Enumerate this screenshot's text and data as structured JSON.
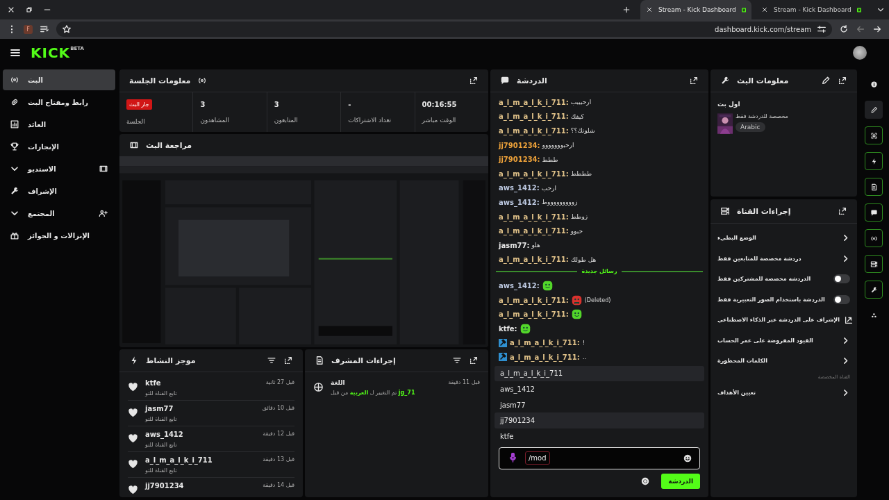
{
  "browser": {
    "tabs": [
      {
        "title": "Stream - Kick Dashboard",
        "selected": false
      },
      {
        "title": "Stream - Kick Dashboard",
        "selected": true
      }
    ],
    "profile": "F",
    "url": "dashboard.kick.com/stream"
  },
  "header": {
    "logo": "KICK",
    "logo_badge": "BETA"
  },
  "sidebar": {
    "items": [
      {
        "label": "البث",
        "kind": "link",
        "selected": true
      },
      {
        "label": "رابط ومفتاح البث",
        "kind": "link",
        "selected": false
      },
      {
        "label": "العائد",
        "kind": "link",
        "selected": false
      },
      {
        "label": "الإنجازات",
        "kind": "link",
        "selected": false
      },
      {
        "label": "الاستديو",
        "kind": "group",
        "selected": false
      },
      {
        "label": "الإشراف",
        "kind": "link",
        "selected": false
      },
      {
        "label": "المجتمع",
        "kind": "group",
        "selected": false
      },
      {
        "label": "الإنزالات و الجوائز",
        "kind": "link",
        "selected": false
      }
    ]
  },
  "session": {
    "title": "معلومات الجلسة",
    "stats": [
      {
        "kind": "number",
        "value": "00:16:55",
        "label": "الوقت مباشر"
      },
      {
        "kind": "number",
        "value": "-",
        "label": "تعداد الاشتراكات"
      },
      {
        "kind": "number",
        "value": "3",
        "label": "المتابعون"
      },
      {
        "kind": "number",
        "value": "3",
        "label": "المشاهدون"
      },
      {
        "kind": "badge",
        "value": "جار البث",
        "label": "الجلسة"
      }
    ]
  },
  "preview": {
    "title": "مراجعة البث",
    "kind": "picture"
  },
  "activity": {
    "title": "موجز النشاط",
    "items": [
      {
        "user": "ktfe",
        "time": "قبل 27 ثانية",
        "action": "تابع القناة للتو"
      },
      {
        "user": "jasm77",
        "time": "قبل 10 دقائق",
        "action": "تابع القناة للتو"
      },
      {
        "user": "aws_1412",
        "time": "قبل 12 دقيقة",
        "action": "تابع القناة للتو"
      },
      {
        "user": "a_l_m_a_l_k_i_711",
        "time": "قبل 13 دقيقة",
        "action": "تابع القناة للتو"
      },
      {
        "user": "jj7901234",
        "time": "قبل 14 دقيقة"
      }
    ]
  },
  "mod_actions": {
    "title": "إجراءات المشرف",
    "items": [
      {
        "title": "اللغة",
        "time": "قبل 11 دقيقة",
        "text": "**jg_71** تم التغيير ل **العربية** من قبل"
      }
    ]
  },
  "chat": {
    "title": "الدردشة",
    "messages": [
      {
        "kind": "text",
        "user": "a_l_m_a_l_k_i_711:",
        "color": "#e2c38a",
        "text": "ارحبيبب"
      },
      {
        "kind": "text",
        "user": "a_l_m_a_l_k_i_711:",
        "color": "#e2c38a",
        "text": "كيفك"
      },
      {
        "kind": "text",
        "user": "a_l_m_a_l_k_i_711:",
        "color": "#e2c38a",
        "text": "شلونك؟؟"
      },
      {
        "kind": "text",
        "user": "jj7901234:",
        "color": "#eea23a",
        "text": "ارحبووووووو"
      },
      {
        "kind": "text",
        "user": "jj7901234:",
        "color": "#eea23a",
        "text": "ططط"
      },
      {
        "kind": "text",
        "user": "a_l_m_a_l_k_i_711:",
        "color": "#e2c38a",
        "text": "طططط"
      },
      {
        "kind": "text",
        "user": "aws_1412:",
        "color": "#bcc8e0",
        "text": "ارحب"
      },
      {
        "kind": "text",
        "user": "aws_1412:",
        "color": "#bcc8e0",
        "text": "زوووووووووط"
      },
      {
        "kind": "text",
        "user": "a_l_m_a_l_k_i_711:",
        "color": "#e2c38a",
        "text": "زوطط"
      },
      {
        "kind": "text",
        "user": "a_l_m_a_l_k_i_711:",
        "color": "#e2c38a",
        "text": "حبوو"
      },
      {
        "kind": "text",
        "user": "jasm77:",
        "color": "#e8e8e8",
        "text": "هلو"
      },
      {
        "kind": "text",
        "user": "a_l_m_a_l_k_i_711:",
        "color": "#e2c38a",
        "text": "هل طولك"
      }
    ],
    "divider": "رسائل جديدة",
    "new_messages": [
      {
        "kind": "emote",
        "user": "aws_1412:",
        "color": "#bcc8e0",
        "deleted": false
      },
      {
        "kind": "emote",
        "user": "a_l_m_a_l_k_i_711:",
        "color": "#e2c38a",
        "deleted": true,
        "note": "(Deleted)"
      },
      {
        "kind": "emote",
        "user": "a_l_m_a_l_k_i_711:",
        "color": "#e2c38a",
        "deleted": false
      },
      {
        "kind": "emote",
        "user": "ktfe:",
        "color": "#e8e8e8",
        "deleted": false
      },
      {
        "kind": "action",
        "user": "a_l_m_a_l_k_i_711:",
        "color": "#e2c38a",
        "text": "!"
      },
      {
        "kind": "action",
        "user": "a_l_m_a_l_k_i_711:",
        "color": "#e2c38a",
        "text": ".."
      }
    ],
    "suggestions": [
      {
        "name": "a_l_m_a_l_k_i_711",
        "selected": true
      },
      {
        "name": "aws_1412",
        "selected": false
      },
      {
        "name": "jasm77",
        "selected": false
      },
      {
        "name": "jj7901234",
        "selected": true
      },
      {
        "name": "ktfe",
        "selected": false
      }
    ],
    "input_value": "/mod",
    "send": "الدردشة"
  },
  "stream_info": {
    "title": "معلومات البث",
    "stream_title": "اول بث",
    "category": "مخصصة للدردشة فقط",
    "tag": "Arabic"
  },
  "channel_actions": {
    "title": "إجراءات القناة",
    "items": [
      {
        "kind": "submenu",
        "label": "الوضع البطيء"
      },
      {
        "kind": "submenu",
        "label": "دردشة مخصصة للمتابعين فقط"
      },
      {
        "kind": "toggle",
        "label": "الدردشة مخصصة للمشتركين فقط",
        "on": false
      },
      {
        "kind": "toggle",
        "label": "الدردشة باستخدام الصور التعبيرية فقط",
        "on": false
      },
      {
        "kind": "external",
        "label": "الإشراف على الدردشة عبر الذكاء الاصطناعي"
      },
      {
        "kind": "submenu",
        "label": "القيود المفروضة على عمر الحساب"
      },
      {
        "kind": "submenu",
        "label": "الكلمات المحظورة"
      },
      {
        "kind": "section",
        "label": "القناة المخصصة"
      },
      {
        "kind": "submenu",
        "label": "تعيين الأهداف"
      }
    ]
  },
  "rail": [
    {
      "kind": "plain",
      "selected": false
    },
    {
      "kind": "plain",
      "selected": true
    },
    {
      "kind": "framed",
      "selected": false
    },
    {
      "kind": "framed",
      "selected": false
    },
    {
      "kind": "framed",
      "selected": false
    },
    {
      "kind": "framed",
      "selected": false
    },
    {
      "kind": "framed",
      "selected": false
    },
    {
      "kind": "framed",
      "selected": false
    },
    {
      "kind": "framed",
      "selected": false
    },
    {
      "kind": "plain",
      "selected": false
    }
  ]
}
